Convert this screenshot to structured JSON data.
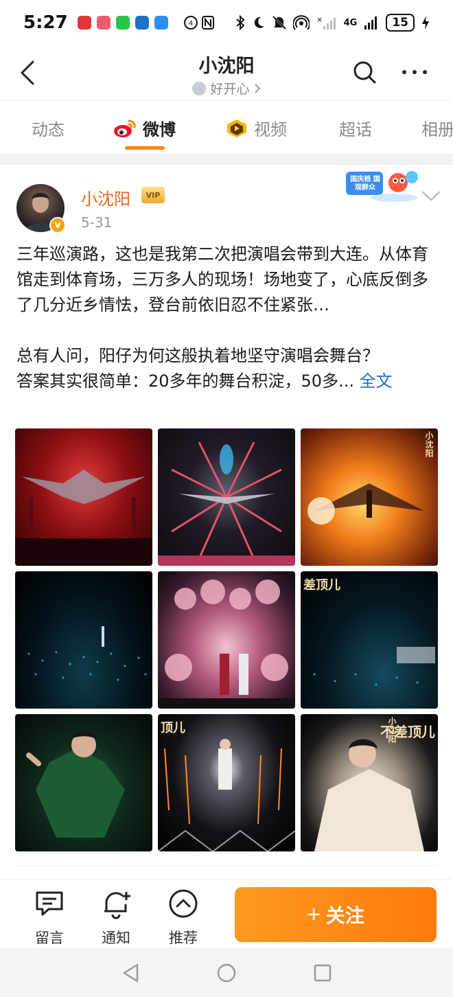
{
  "status_bar": {
    "time": "5:27",
    "network_label": "4G",
    "battery": "15",
    "notification_icons": [
      {
        "name": "huawei-app-icon",
        "color": "#e5343a"
      },
      {
        "name": "game-app-icon",
        "color": "#f05a6a"
      },
      {
        "name": "wechat-icon",
        "color": "#28c445"
      },
      {
        "name": "bird-app-icon",
        "color": "#1a73c7"
      },
      {
        "name": "cloud-app-icon",
        "color": "#2a8ef2"
      }
    ]
  },
  "header": {
    "title": "小沈阳",
    "subtitle": "好开心"
  },
  "tabs": [
    {
      "label": "动态",
      "active": false
    },
    {
      "label": "微博",
      "active": true
    },
    {
      "label": "视频",
      "active": false
    },
    {
      "label": "超话",
      "active": false
    },
    {
      "label": "相册",
      "active": false
    }
  ],
  "post": {
    "author": "小沈阳",
    "date": "5-31",
    "vip_label": "VIP",
    "verified_mark": "v",
    "paragraph1": "三年巡演路，这也是我第二次把演唱会带到大连。从体育馆走到体育场，三万多人的现场！场地变了，心底反倒多了几分近乡情怯，登台前依旧忍不住紧张…",
    "paragraph2_line1": "总有人问，阳仔为何这般执着地坚守演唱会舞台？",
    "paragraph2_line2": "答案其实很简单：20多年的舞台积淀，50多...",
    "more_link": "全文",
    "promo_badge": "国庆档 国观群众",
    "photo_captions": {
      "p3": "小沈阳",
      "p6": "差顶儿",
      "p8": "顶儿",
      "p9_vertical": "小沈阳",
      "p9_title": "不差顶儿"
    },
    "accent_color": "#ff8200"
  },
  "bottom_bar": {
    "comment_label": "留言",
    "notify_label": "通知",
    "recommend_label": "推荐",
    "follow_label": "关注",
    "follow_plus": "+"
  }
}
